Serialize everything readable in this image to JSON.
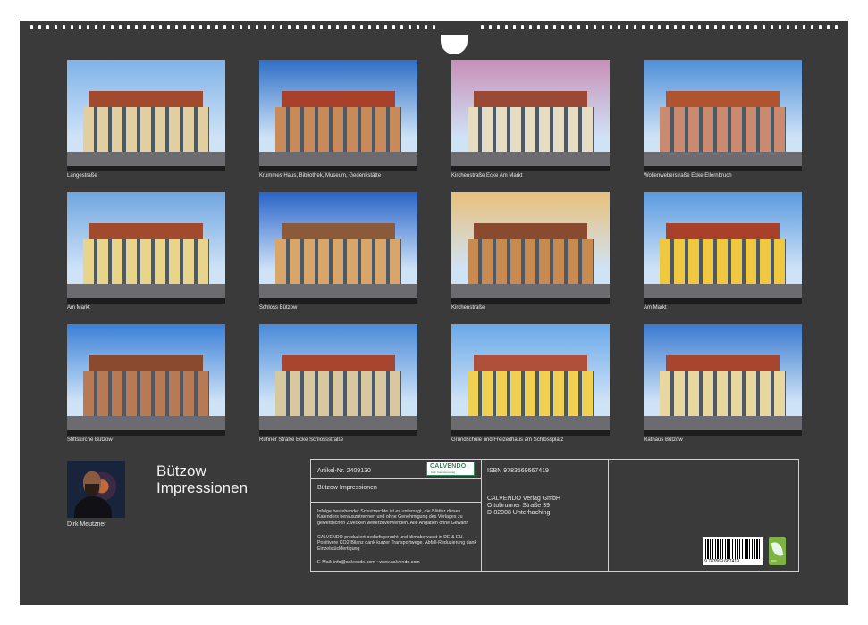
{
  "photos": [
    {
      "caption": "Langestraße",
      "colors": {
        "sky": "#7fb3e8",
        "building": "#e2cfa0",
        "roof": "#a24a2e"
      }
    },
    {
      "caption": "Krummes Haus, Bibliothek, Museum, Gedenkstätte",
      "colors": {
        "sky": "#2f6fc6",
        "building": "#c98a5a",
        "roof": "#a8402a"
      }
    },
    {
      "caption": "Kirchenstraße Ecke Am Markt",
      "colors": {
        "sky": "#c88fb8",
        "building": "#e6dcc2",
        "roof": "#9a4a34"
      }
    },
    {
      "caption": "Wollenweberstraße Ecke Ellernbruch",
      "colors": {
        "sky": "#4f8fd8",
        "building": "#c98a70",
        "roof": "#b0532f"
      }
    },
    {
      "caption": "Am Markt",
      "colors": {
        "sky": "#6fa6e0",
        "building": "#e8d48a",
        "roof": "#a24a2e"
      }
    },
    {
      "caption": "Schloss Bützow",
      "colors": {
        "sky": "#2a64c8",
        "building": "#d8a56a",
        "roof": "#8a5a3a"
      }
    },
    {
      "caption": "Kirchenstraße",
      "colors": {
        "sky": "#e8c07a",
        "building": "#c98a50",
        "roof": "#8a4a30"
      }
    },
    {
      "caption": "Am Markt",
      "colors": {
        "sky": "#5a9ae0",
        "building": "#f0c840",
        "roof": "#a8402a"
      }
    },
    {
      "caption": "Stiftskirche Bützow",
      "colors": {
        "sky": "#3a80d8",
        "building": "#b87a52",
        "roof": "#8a4a30"
      }
    },
    {
      "caption": "Rühner Straße Ecke Schlossstraße",
      "colors": {
        "sky": "#4a8ad8",
        "building": "#d8c8a0",
        "roof": "#a8452e"
      }
    },
    {
      "caption": "Grundschule und Freizeithaus am Schlossplatz",
      "colors": {
        "sky": "#6aa8e8",
        "building": "#f0d050",
        "roof": "#b0503a"
      }
    },
    {
      "caption": "Rathaus Bützow",
      "colors": {
        "sky": "#3a7ad0",
        "building": "#e8d8a0",
        "roof": "#a8452e"
      }
    }
  ],
  "title": {
    "line1": "Bützow",
    "line2": "Impressionen"
  },
  "author": "Dirk Meutzner",
  "info": {
    "article": "Artikel-Nr. 2409130",
    "calendar_title": "Bützow Impressionen",
    "legal": "Infolge bestehender Schutzrechte ist es untersagt, die Blätter dieses Kalenders herauszutrennen und ohne Genehmigung des Verlages zu gewerblichen Zwecken weiterzuverwenden. Alle Angaben ohne Gewähr.",
    "climate": "CALVENDO produziert bedarfsgerecht und klimabewusst in DE & EU. Positivere CO2-Bilanz dank kurzer Transportwege. Abfall-Reduzierung dank Einzelstückfertigung",
    "contact": "E-Mail: info@calvendo.com • www.calvendo.com",
    "isbn": "ISBN 9783569667419",
    "publisher_lines": [
      "CALVENDO Verlag GmbH",
      "Ottobrunner Straße 39",
      "D-82008 Unterhaching"
    ],
    "logo_word": "CALVENDO",
    "logo_sub": "Dein Kalenderverlag",
    "barcode_number": "9 783569 667419",
    "eco_label": "eco"
  }
}
